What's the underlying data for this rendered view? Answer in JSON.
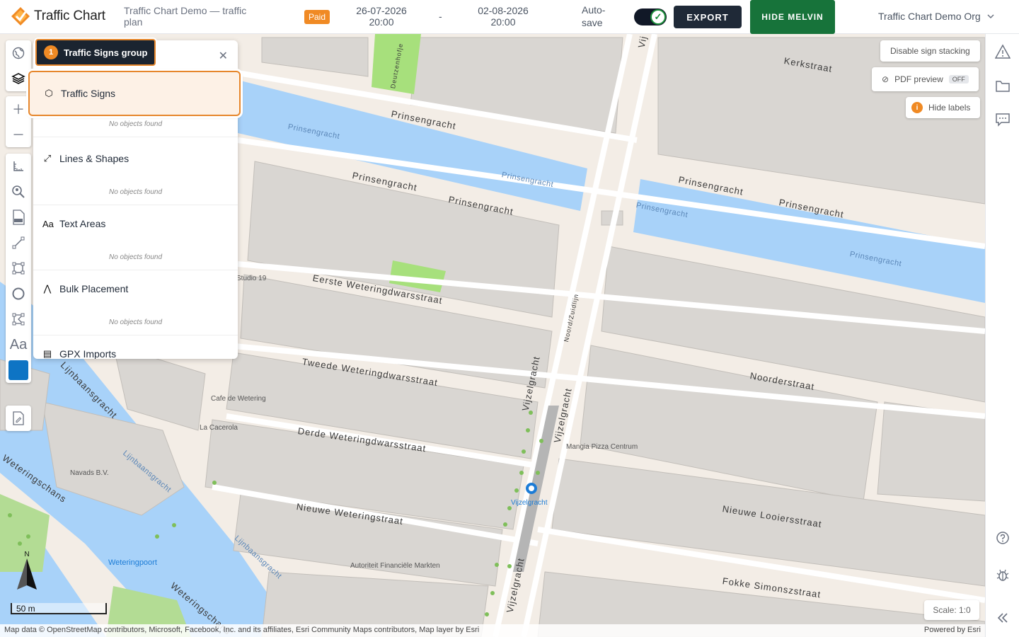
{
  "header": {
    "app_name": "Traffic Chart",
    "plan_title": "Traffic Chart Demo — traffic plan",
    "paid_badge": "Paid",
    "start_date": "26-07-2026",
    "start_time": "20:00",
    "date_separator": "-",
    "end_date": "02-08-2026",
    "end_time": "20:00",
    "autosave_label": "Auto-save",
    "autosave_on": true,
    "export_label": "EXPORT",
    "hide_label": "HIDE MELVIN",
    "org_name": "Traffic Chart Demo Org"
  },
  "layers_panel": {
    "tab_label": "Traffic Signs group",
    "tab_number": "1",
    "layers": [
      {
        "name": "Traffic Signs",
        "empty_text": "No objects found",
        "icon": "hexagon-icon"
      },
      {
        "name": "Lines & Shapes",
        "empty_text": "No objects found",
        "icon": "line-icon"
      },
      {
        "name": "Text Areas",
        "empty_text": "No objects found",
        "icon": "text-icon"
      },
      {
        "name": "Bulk Placement",
        "empty_text": "No objects found",
        "icon": "bulk-icon"
      },
      {
        "name": "GPX Imports",
        "empty_text": "",
        "icon": "gpx-icon"
      }
    ]
  },
  "map_controls": {
    "disable_stacking": "Disable sign stacking",
    "pdf_preview": "PDF preview",
    "pdf_preview_state": "OFF",
    "hide_labels": "Hide labels",
    "scale": "Scale: 1:0",
    "scale_bar": "50 m",
    "north": "N"
  },
  "map_labels": {
    "streets": [
      "Kerkstraat",
      "Prinsengracht",
      "Prinsengracht",
      "Prinsengracht",
      "Prinsengracht",
      "Prinsengracht",
      "Eerste Weteringdwarsstraat",
      "Tweede Weteringdwarsstraat",
      "Derde Weteringdwarsstraat",
      "Nieuwe Weteringstraat",
      "Noorderstraat",
      "Nieuwe Looiersstraat",
      "Fokke Simonszstraat",
      "Vijzelgracht",
      "Vijzelgracht",
      "Vijzelgracht",
      "Weteringschans",
      "Weteringschans",
      "Lijnbaansgracht",
      "Deutzenhofje",
      "Noord/Zuidlijn",
      "Vij"
    ],
    "water": [
      "Prinsengracht",
      "Prinsengracht",
      "Prinsengracht",
      "Prinsengracht",
      "Lijnbaansgracht",
      "Lijnbaansgracht"
    ],
    "pois": [
      "Studio 19",
      "Cafe de Wetering",
      "La Cacerola",
      "Navads B.V.",
      "Mangia Pizza Centrum",
      "Vijzelgracht",
      "Weteringpoort",
      "Autoriteit Financiële Markten"
    ]
  },
  "attribution": "Map data © OpenStreetMap contributors, Microsoft, Facebook, Inc. and its affiliates, Esri Community Maps contributors, Map layer by Esri",
  "powered_by": "Powered by Esri",
  "colors": {
    "brand_orange": "#f08a24",
    "dark_navy": "#1b2430",
    "green_button": "#17733a",
    "water": "#a8d2f9",
    "building": "#d9d6d2",
    "active_color": "#0e74c4"
  }
}
